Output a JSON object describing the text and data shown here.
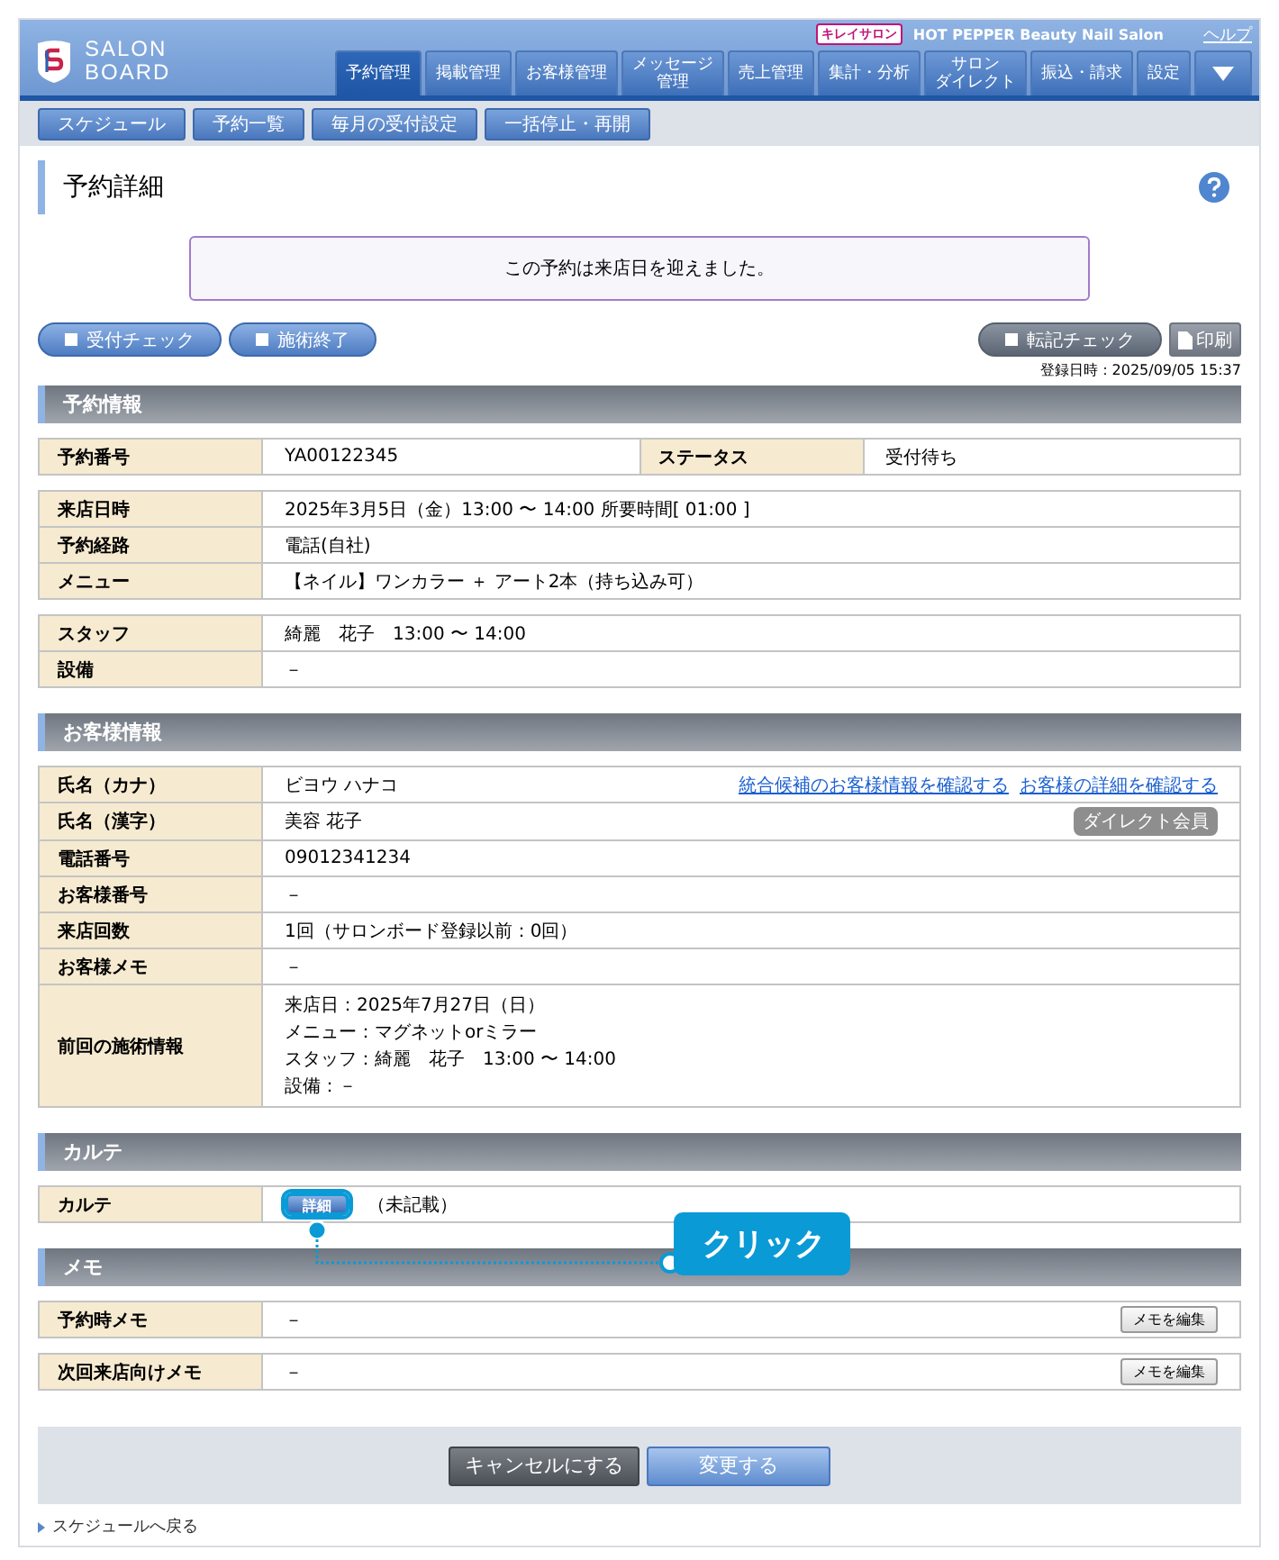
{
  "header": {
    "logo_lines": [
      "SALON",
      "BOARD"
    ],
    "brand_badge": "キレイサロン",
    "brand": "HOT PEPPER Beauty Nail Salon",
    "help": "ヘルプ",
    "nav": [
      {
        "lines": [
          "予約管理"
        ],
        "selected": true
      },
      {
        "lines": [
          "掲載管理"
        ],
        "selected": false
      },
      {
        "lines": [
          "お客様管理"
        ],
        "selected": false
      },
      {
        "lines": [
          "メッセージ",
          "管理"
        ],
        "selected": false
      },
      {
        "lines": [
          "売上管理"
        ],
        "selected": false
      },
      {
        "lines": [
          "集計・分析"
        ],
        "selected": false
      },
      {
        "lines": [
          "サロン",
          "ダイレクト"
        ],
        "selected": false
      },
      {
        "lines": [
          "振込・請求"
        ],
        "selected": false
      },
      {
        "lines": [
          "設定"
        ],
        "selected": false
      }
    ]
  },
  "subnav": [
    "スケジュール",
    "予約一覧",
    "毎月の受付設定",
    "一括停止・再開"
  ],
  "page_title": "予約詳細",
  "notice": "この予約は来店日を迎えました。",
  "left_actions": [
    "受付チェック",
    "施術終了"
  ],
  "transcribe_button": "転記チェック",
  "print_button": "印刷",
  "registered": "登録日時：2025/09/05 15:37",
  "sections": [
    {
      "title": "予約情報",
      "groups": [
        [
          {
            "cells": [
              {
                "kind": "label",
                "text": "予約番号"
              },
              {
                "kind": "value",
                "text": "YA00122345"
              },
              {
                "kind": "label",
                "text": "ステータス"
              },
              {
                "kind": "value",
                "text": "受付待ち"
              }
            ]
          }
        ],
        [
          {
            "cells": [
              {
                "kind": "label",
                "text": "来店日時"
              },
              {
                "kind": "value",
                "text": "2025年3月5日（金）13:00 〜 14:00 所要時間[ 01:00 ]"
              }
            ]
          },
          {
            "cells": [
              {
                "kind": "label",
                "text": "予約経路"
              },
              {
                "kind": "value",
                "text": "電話(自社)"
              }
            ]
          },
          {
            "cells": [
              {
                "kind": "label",
                "text": "メニュー"
              },
              {
                "kind": "value",
                "text": "【ネイル】ワンカラー ＋ アート2本（持ち込み可）"
              }
            ]
          }
        ],
        [
          {
            "cells": [
              {
                "kind": "label",
                "text": "スタッフ"
              },
              {
                "kind": "value",
                "text": "綺麗　花子　13:00 〜 14:00"
              }
            ]
          },
          {
            "cells": [
              {
                "kind": "label",
                "text": "設備"
              },
              {
                "kind": "value",
                "text": "－"
              }
            ]
          }
        ]
      ]
    },
    {
      "title": "お客様情報",
      "groups": [
        [
          {
            "cells": [
              {
                "kind": "label",
                "text": "氏名（カナ）"
              },
              {
                "kind": "value",
                "text": "ビヨウ ハナコ",
                "links": [
                  "統合候補のお客様情報を確認する",
                  "お客様の詳細を確認する"
                ]
              }
            ]
          },
          {
            "cells": [
              {
                "kind": "label",
                "text": "氏名（漢字）"
              },
              {
                "kind": "value",
                "text": "美容 花子",
                "badge": "ダイレクト会員"
              }
            ]
          },
          {
            "cells": [
              {
                "kind": "label",
                "text": "電話番号"
              },
              {
                "kind": "value",
                "text": "09012341234"
              }
            ]
          },
          {
            "cells": [
              {
                "kind": "label",
                "text": "お客様番号"
              },
              {
                "kind": "value",
                "text": "－"
              }
            ]
          },
          {
            "cells": [
              {
                "kind": "label",
                "text": "来店回数"
              },
              {
                "kind": "value",
                "text": "1回（サロンボード登録以前：0回）"
              }
            ]
          },
          {
            "cells": [
              {
                "kind": "label",
                "text": "お客様メモ"
              },
              {
                "kind": "value",
                "text": "－"
              }
            ]
          },
          {
            "cells": [
              {
                "kind": "label",
                "text": "前回の施術情報"
              },
              {
                "kind": "value",
                "lines": [
                  "来店日：2025年7月27日（日）",
                  "メニュー：マグネットorミラー",
                  "スタッフ：綺麗　花子　13:00 〜 14:00",
                  "設備：－"
                ]
              }
            ]
          }
        ]
      ]
    },
    {
      "title": "カルテ",
      "groups": [
        [
          {
            "cells": [
              {
                "kind": "label",
                "text": "カルテ"
              },
              {
                "kind": "value",
                "button": "詳細",
                "text": "（未記載）",
                "callout": "クリック"
              }
            ]
          }
        ]
      ]
    },
    {
      "title": "メモ",
      "groups": [
        [
          {
            "cells": [
              {
                "kind": "label",
                "text": "予約時メモ"
              },
              {
                "kind": "value",
                "text": "－",
                "edit_button": "メモを編集"
              }
            ]
          }
        ],
        [
          {
            "cells": [
              {
                "kind": "label",
                "text": "次回来店向けメモ"
              },
              {
                "kind": "value",
                "text": "－",
                "edit_button": "メモを編集"
              }
            ]
          }
        ]
      ]
    }
  ],
  "cancel_button": "キャンセルにする",
  "submit_button": "変更する",
  "back_link": "スケジュールへ戻る"
}
